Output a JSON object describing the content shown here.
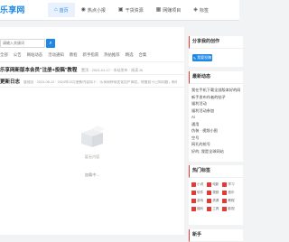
{
  "site": {
    "logo": "乐享网"
  },
  "nav": [
    {
      "label": "首页",
      "icon": "home-icon",
      "glyph": "⌂",
      "active": true
    },
    {
      "label": "热点小报",
      "icon": "fire-icon",
      "glyph": "◉",
      "active": false
    },
    {
      "label": "干货资源",
      "icon": "box-icon",
      "glyph": "▣",
      "active": false
    },
    {
      "label": "网赚项目",
      "icon": "grid-icon",
      "glyph": "▦",
      "active": false
    },
    {
      "label": "标签",
      "icon": "tag-icon",
      "glyph": "◈",
      "active": false
    }
  ],
  "search": {
    "placeholder": "请输入关键词",
    "button_icon": "search-icon"
  },
  "categories": [
    "全部",
    "公告",
    "网站动态",
    "活动通知",
    "教程",
    "新手指南",
    "热帖推荐",
    "精选",
    "合集"
  ],
  "posts": [
    {
      "title": "乐享网新版本会员\"注册+投稿\"教程",
      "meta": "置顶 · 2024-01-17 · 本站发布 · 阅读 2k"
    },
    {
      "title": "更新日志",
      "meta": "管理员 · 2024-08-12 · 2024年12月更新内容如下：乐享网持续优化用户体验，修复若干已知问题，新增多个功能模块并完善站内导航"
    }
  ],
  "empty": {
    "text": "暂无内容",
    "icon": "empty-box-icon"
  },
  "load_more": "加载中...",
  "sidebar": {
    "share": {
      "title": "分享我的创作",
      "button": "我要投稿"
    },
    "hot": {
      "title": "最新动态",
      "items": [
        "我在手机下载全部版本好的网站",
        "新手发布作者的帖子",
        "福利活动",
        "福利活动参加",
        "Ai",
        "通用",
        "伪装 · 视频小图",
        "空号",
        "网孔的抢号",
        "好的, 我是全球网站"
      ]
    },
    "tags": {
      "title": "热门标签",
      "items": [
        "小说",
        "电影",
        "学习",
        "软件",
        "视频",
        "音乐",
        "游戏",
        "资源",
        "教程",
        "福利",
        "工具",
        "影视"
      ]
    },
    "new": {
      "title": "新手"
    }
  }
}
